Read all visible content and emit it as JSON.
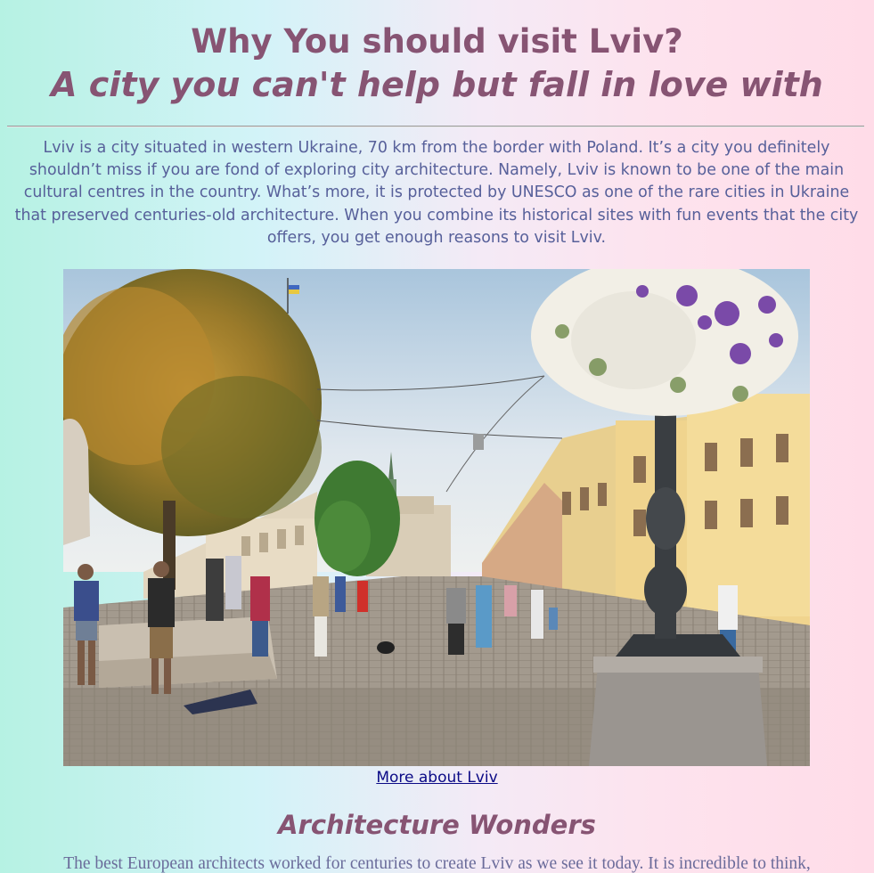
{
  "header": {
    "title_line1": "Why You should visit Lviv?",
    "title_line2": "A city you can't help but fall in love with"
  },
  "intro": {
    "text": "Lviv is a city situated in western Ukraine, 70 km from the border with Poland. It’s a city you definitely shouldn’t miss if you are fond of exploring city architecture. Namely, Lviv is known to be one of the main cultural centres in the country. What’s more, it is protected by UNESCO as one of the rare cities in Ukraine that preserved centuries-old architecture. When you combine its historical sites with fun events that the city offers, you get enough reasons to visit Lviv."
  },
  "hero_image": {
    "alt": "Lviv"
  },
  "more_link": {
    "label": "More about Lviv"
  },
  "section": {
    "heading": "Architecture Wonders",
    "text": "The best European architects worked for centuries to create Lviv as we see it today. It is incredible to think,"
  },
  "colors": {
    "heading": "#875473",
    "body_text": "#57609a",
    "link": "#0b0a86",
    "background_left": "#b6f2e3",
    "background_right": "#ffdce8"
  }
}
